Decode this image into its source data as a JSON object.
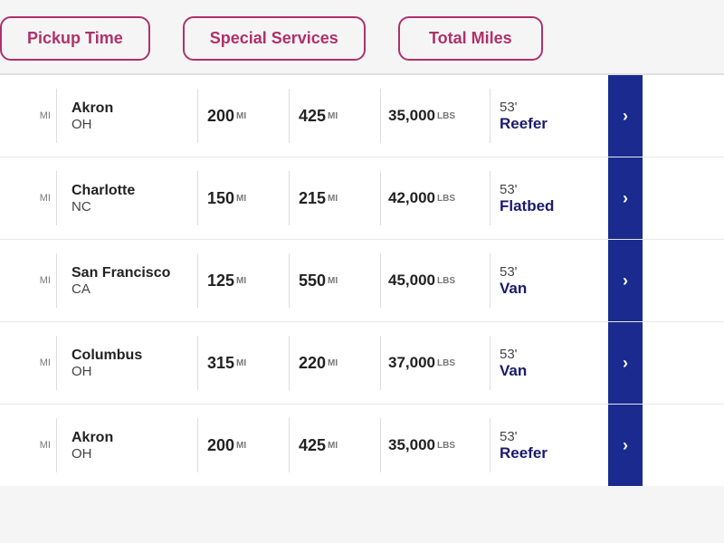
{
  "tabs": [
    {
      "id": "pickup-time",
      "label": "Pickup Time"
    },
    {
      "id": "special-services",
      "label": "Special Services"
    },
    {
      "id": "total-miles",
      "label": "Total Miles"
    }
  ],
  "rows": [
    {
      "left_miles": {
        "val": "",
        "unit": "MI"
      },
      "destination_city": "Akron",
      "destination_state": "OH",
      "miles1": {
        "val": "200",
        "unit": "MI"
      },
      "miles2": {
        "val": "425",
        "unit": "MI"
      },
      "weight": {
        "val": "35,000",
        "unit": "LBS"
      },
      "trailer_size": "53'",
      "trailer_type": "Reefer"
    },
    {
      "left_miles": {
        "val": "",
        "unit": "MI"
      },
      "destination_city": "Charlotte",
      "destination_state": "NC",
      "miles1": {
        "val": "150",
        "unit": "MI"
      },
      "miles2": {
        "val": "215",
        "unit": "MI"
      },
      "weight": {
        "val": "42,000",
        "unit": "LBS"
      },
      "trailer_size": "53'",
      "trailer_type": "Flatbed"
    },
    {
      "left_miles": {
        "val": "",
        "unit": "MI"
      },
      "destination_city": "San Francisco",
      "destination_state": "CA",
      "miles1": {
        "val": "125",
        "unit": "MI"
      },
      "miles2": {
        "val": "550",
        "unit": "MI"
      },
      "weight": {
        "val": "45,000",
        "unit": "LBS"
      },
      "trailer_size": "53'",
      "trailer_type": "Van"
    },
    {
      "left_miles": {
        "val": "",
        "unit": "MI"
      },
      "destination_city": "Columbus",
      "destination_state": "OH",
      "miles1": {
        "val": "315",
        "unit": "MI"
      },
      "miles2": {
        "val": "220",
        "unit": "MI"
      },
      "weight": {
        "val": "37,000",
        "unit": "LBS"
      },
      "trailer_size": "53'",
      "trailer_type": "Van"
    },
    {
      "left_miles": {
        "val": "",
        "unit": "MI"
      },
      "destination_city": "Akron",
      "destination_state": "OH",
      "miles1": {
        "val": "200",
        "unit": "MI"
      },
      "miles2": {
        "val": "425",
        "unit": "MI"
      },
      "weight": {
        "val": "35,000",
        "unit": "LBS"
      },
      "trailer_size": "53'",
      "trailer_type": "Reefer"
    }
  ],
  "action_chevron": "›"
}
